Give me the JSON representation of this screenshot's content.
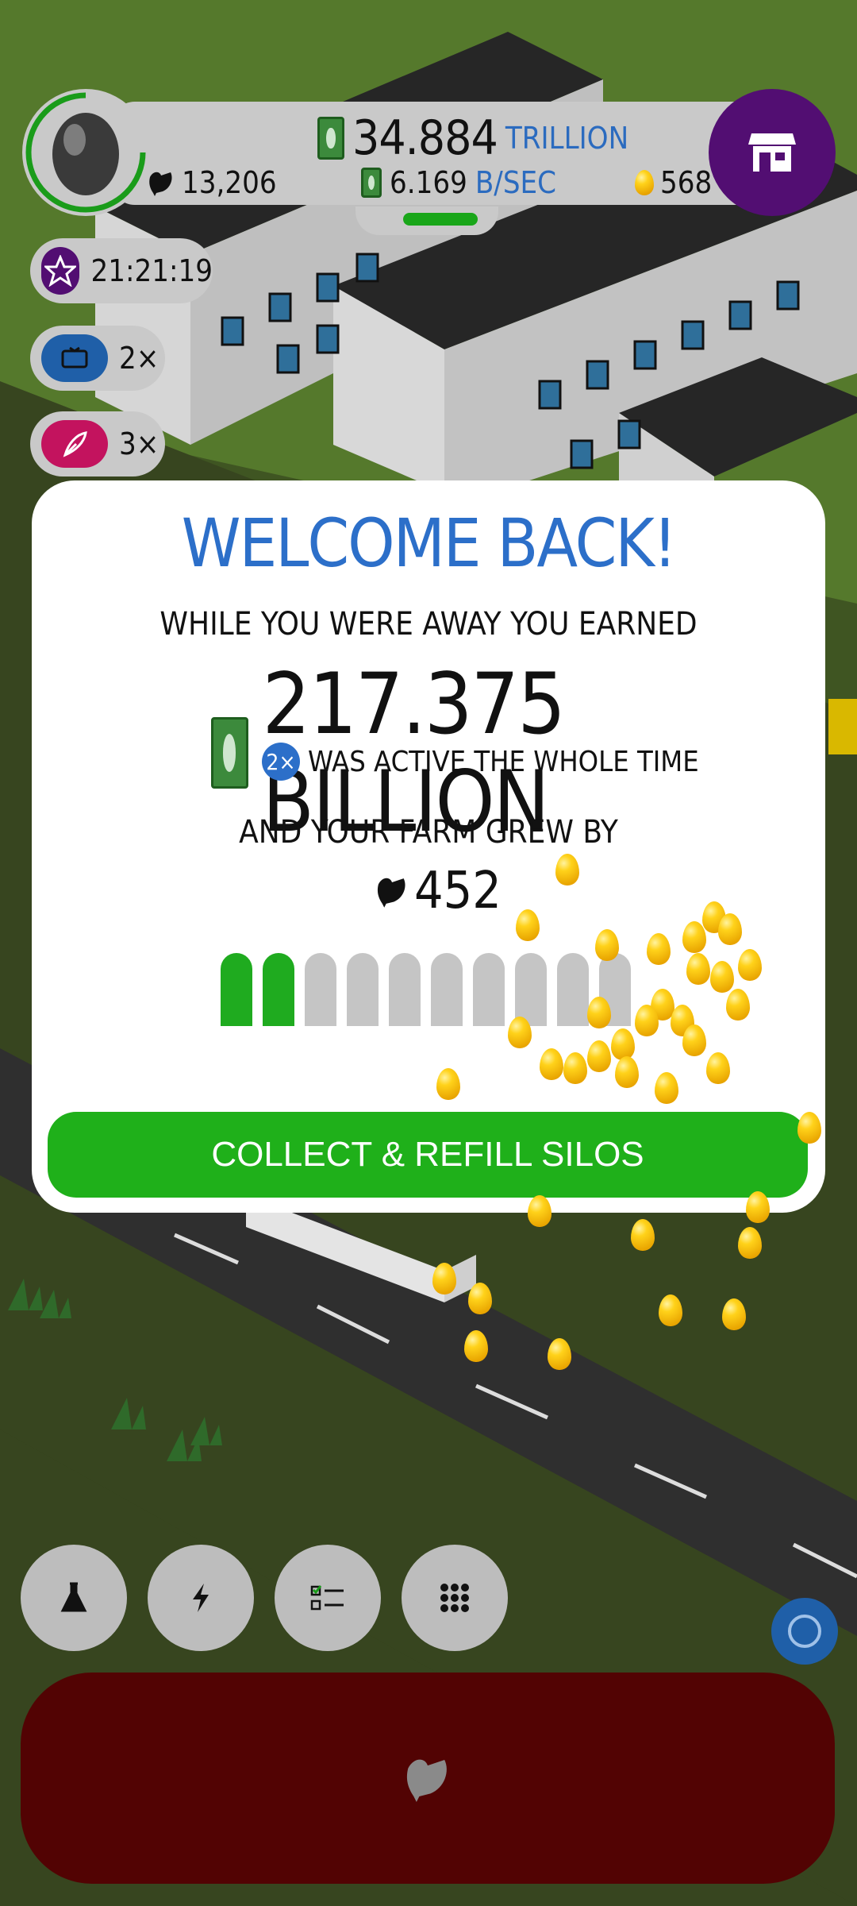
{
  "top_hud": {
    "cash_amount": "34.884",
    "cash_unit": "TRILLION",
    "chicken_count": "13,206",
    "earning_rate": "6.169",
    "earning_rate_unit": "B/SEC",
    "golden_eggs": "568"
  },
  "boosts": {
    "timer": "21:21:19",
    "video_multiplier": "2×",
    "feather_multiplier": "3×"
  },
  "modal": {
    "title": "WELCOME BACK!",
    "subtitle": "WHILE YOU WERE AWAY YOU EARNED",
    "amount": "217.375 BILLION",
    "boost_badge": "2×",
    "boost_text": "WAS ACTIVE THE WHOLE TIME",
    "farm_grew_text": "AND YOUR FARM GREW BY",
    "chickens_gained": "452",
    "silos_full": 2,
    "silos_total": 10,
    "collect_button": "COLLECT & REFILL SILOS"
  },
  "colors": {
    "accent_blue": "#2c6fc9",
    "green": "#1fb01a",
    "store_purple": "#520e72",
    "hatch_red": "#520303"
  },
  "icons": [
    "chicken-icon",
    "cash-bill-icon",
    "golden-egg-icon",
    "store-icon",
    "star-icon",
    "video-icon",
    "feather-icon",
    "flask-icon",
    "lightning-icon",
    "checklist-icon",
    "grid-menu-icon",
    "hatch-chicken-icon"
  ]
}
